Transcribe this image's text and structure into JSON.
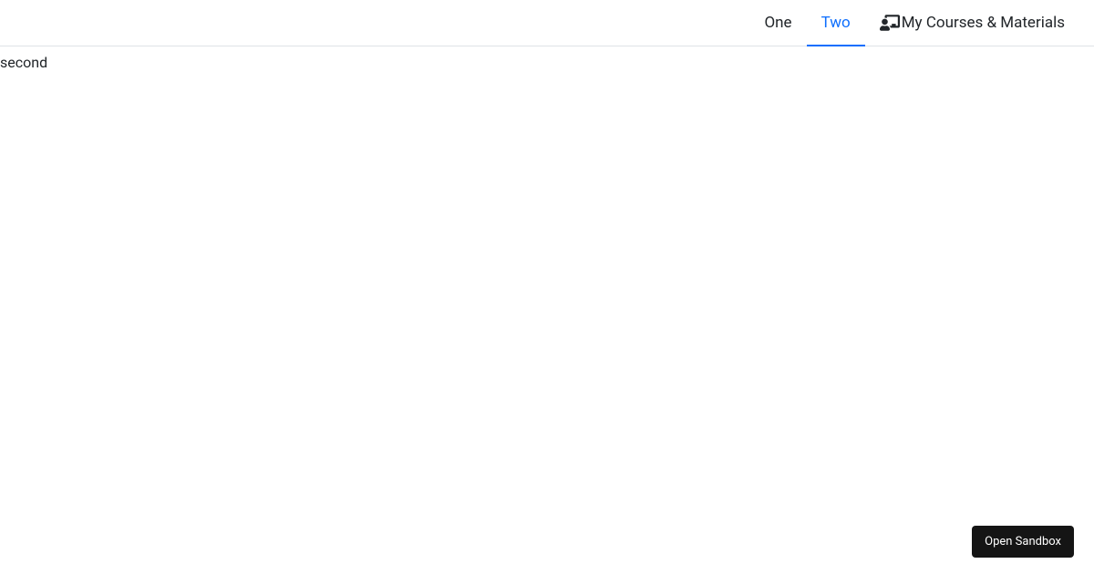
{
  "nav": {
    "items": [
      {
        "label": "One"
      },
      {
        "label": "Two"
      },
      {
        "label": "My Courses & Materials"
      }
    ],
    "active_index": 1
  },
  "content": {
    "text": "second"
  },
  "sandbox": {
    "label": "Open Sandbox"
  }
}
